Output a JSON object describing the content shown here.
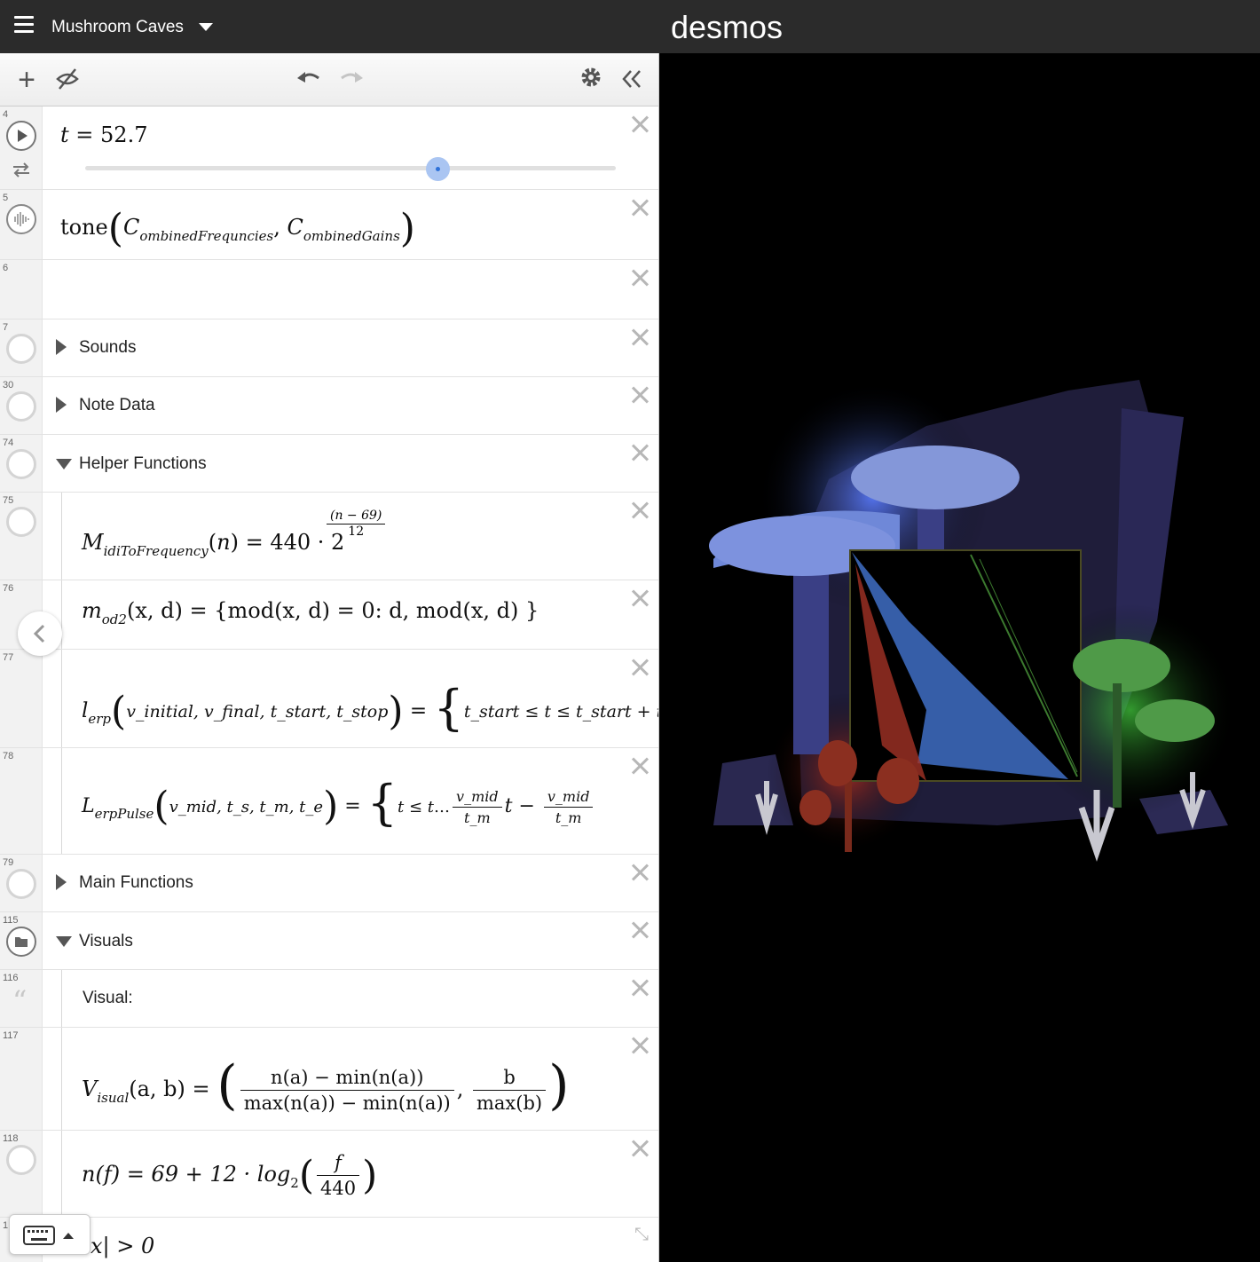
{
  "header": {
    "graph_title": "Mushroom Caves",
    "brand": "desmos"
  },
  "toolbar": {
    "add": "add-item",
    "hide": "toggle-visibility",
    "undo": "undo",
    "redo": "redo",
    "settings": "settings",
    "collapse": "collapse-list"
  },
  "expressions": {
    "r4": {
      "line": "4",
      "var": "t",
      "value": "52.7",
      "min": "−1",
      "max": "80",
      "fraction": 0.664
    },
    "r5": {
      "line": "5",
      "fn": "tone",
      "a1": "C",
      "a1sub": "ombinedFrequncies",
      "a2": "C",
      "a2sub": "ombinedGains"
    },
    "r6": {
      "line": "6"
    },
    "r7": {
      "line": "7",
      "title": "Sounds"
    },
    "r30": {
      "line": "30",
      "title": "Note Data"
    },
    "r74": {
      "line": "74",
      "title": "Helper Functions"
    },
    "r75": {
      "line": "75",
      "name": "M",
      "sub": "idiToFrequency",
      "arg": "n",
      "rhs": "= 440 · 2",
      "exp_num": "(n − 69)",
      "exp_den": "12"
    },
    "r76": {
      "line": "76",
      "name": "m",
      "sub": "od2",
      "args": "(x, d)",
      "rhs": "= {mod(x, d) = 0: d,  mod(x, d) }"
    },
    "r77": {
      "line": "77",
      "name": "l",
      "sub": "erp",
      "lhs_args": "v_initial, v_final, t_start, t_stop",
      "rhs": "t_start ≤ t ≤ t_start + t_stop : v_initia"
    },
    "r78": {
      "line": "78",
      "name": "L",
      "sub": "erpPulse",
      "lhs_args": "v_mid, t_s, t_m, t_e",
      "rhs_start": "t ≤ t",
      "frac1_num": "v_mid",
      "frac1_den": "t_m",
      "frac2_num": "v_mid",
      "frac2_den": "t_m"
    },
    "r79": {
      "line": "79",
      "title": "Main Functions"
    },
    "r115": {
      "line": "115",
      "title": "Visuals"
    },
    "r116": {
      "line": "116",
      "text": "Visual:"
    },
    "r117": {
      "line": "117",
      "name": "V",
      "sub": "isual",
      "args": "(a, b) =",
      "num1": "n(a) − min(n(a))",
      "den1": "max(n(a)) − min(n(a))",
      "num2": "b",
      "den2": "max(b)"
    },
    "r118": {
      "line": "118",
      "lhs": "n(f) = 69 + 12 · log",
      "base": "2",
      "num": "f",
      "den": "440"
    },
    "r119": {
      "line": "1",
      "text": "x| > 0"
    }
  },
  "colors": {
    "accent": "#2d70d8",
    "topbar": "#2b2b2b",
    "graph_bg": "#000000"
  },
  "icons": [
    "menu-icon",
    "caret-down-icon",
    "plus-icon",
    "visibility-off-icon",
    "undo-icon",
    "redo-icon",
    "gear-icon",
    "double-chevron-left-icon",
    "play-icon",
    "loop-icon",
    "sound-icon",
    "folder-icon",
    "quote-icon",
    "keyboard-icon",
    "chevron-left-icon",
    "close-icon"
  ]
}
